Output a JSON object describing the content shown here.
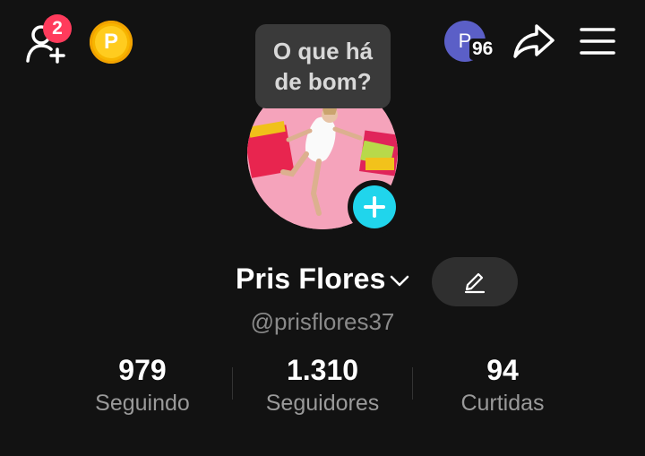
{
  "topbar": {
    "notifications_badge": "2",
    "coin_letter": "P",
    "avatar_letter": "P",
    "avatar_count": "96"
  },
  "tooltip": {
    "line1": "O que há",
    "line2": "de bom?"
  },
  "profile": {
    "name": "Pris Flores",
    "username": "@prisflores37"
  },
  "stats": [
    {
      "value": "979",
      "label": "Seguindo"
    },
    {
      "value": "1.310",
      "label": "Seguidores"
    },
    {
      "value": "94",
      "label": "Curtidas"
    }
  ],
  "colors": {
    "background": "#121212",
    "badge": "#ff3b5c",
    "coin": "#ffcc1f",
    "add_story": "#20d5ec",
    "avatar": "#5b5fc7"
  }
}
